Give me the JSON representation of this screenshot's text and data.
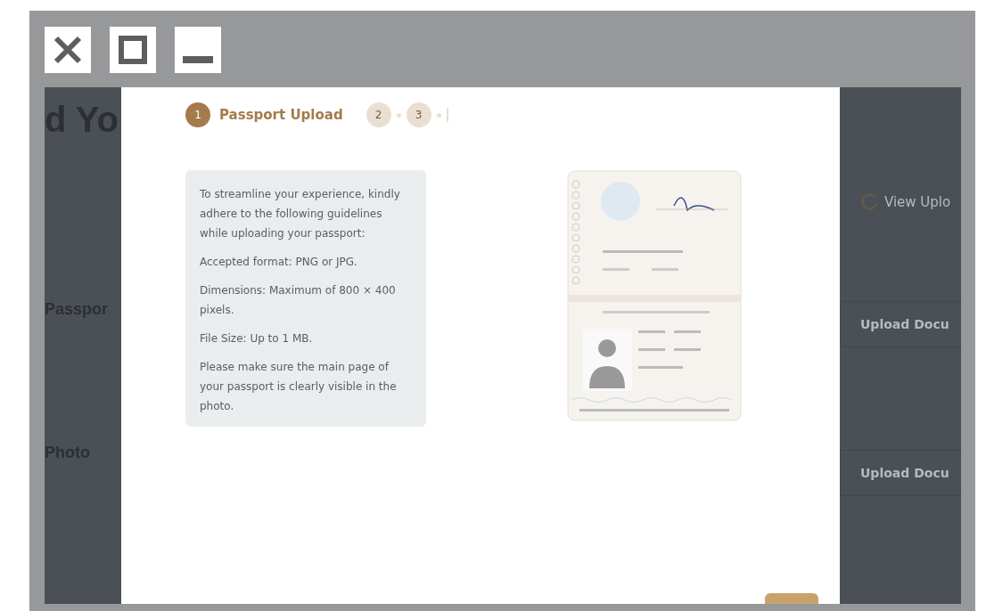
{
  "window_controls": [
    {
      "kind": "close"
    },
    {
      "kind": "maximize"
    },
    {
      "kind": "minimize"
    }
  ],
  "background_page": {
    "heading": "d Yo",
    "sections": [
      {
        "title": "Passpor"
      },
      {
        "title": "Photo"
      }
    ],
    "view_link": "View Uplo",
    "upload_buttons": [
      "Upload Docu",
      "Upload Docu"
    ]
  },
  "modal": {
    "steps": [
      {
        "number": "1",
        "label": "Passport Upload",
        "selected": true
      },
      {
        "number": "2",
        "selected": false
      },
      {
        "number": "3",
        "selected": false
      }
    ],
    "guidelines": [
      "To streamline your experience, kindly adhere to the following guidelines while uploading your passport:",
      "Accepted format: PNG or JPG.",
      "Dimensions: Maximum of 800 × 400 pixels.",
      "File Size: Up to 1 MB.",
      "Please make sure the main page of your passport is clearly visible in the photo."
    ]
  }
}
